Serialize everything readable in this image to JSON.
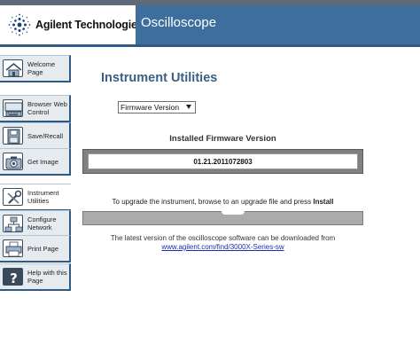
{
  "brand": {
    "name": "Agilent Technologies"
  },
  "header": {
    "title": "Oscilloscope"
  },
  "sidebar": {
    "items": [
      {
        "label": "Welcome Page",
        "icon": "home-icon",
        "active": false
      },
      {
        "label": "Browser Web Control",
        "icon": "keyboard-icon",
        "active": false
      },
      {
        "label": "Save/Recall",
        "icon": "floppy-disk-icon",
        "active": false
      },
      {
        "label": "Get Image",
        "icon": "camera-icon",
        "active": false
      },
      {
        "label": "Instrument Utilities",
        "icon": "tools-icon",
        "active": true
      },
      {
        "label": "Configure Network",
        "icon": "network-icon",
        "active": false
      },
      {
        "label": "Print Page",
        "icon": "printer-icon",
        "active": false
      },
      {
        "label": "Help with this Page",
        "icon": "help-icon",
        "active": false
      }
    ]
  },
  "main": {
    "title": "Instrument Utilities",
    "selector": {
      "value": "Firmware Version"
    },
    "installed_heading": "Installed Firmware Version",
    "installed_version": "01.21.2011072803",
    "upgrade_text_prefix": "To upgrade the instrument, browse to an upgrade file and press ",
    "upgrade_text_bold": "Install",
    "info_text": "The latest version of the oscilloscope software can be downloaded from",
    "info_link": "www.agilent.com/find/3000X-Series-sw"
  },
  "colors": {
    "header_band": "#3e6e9e",
    "header_rule": "#2e5a86",
    "page_title": "#3b5f82",
    "link": "#1a2fb0"
  }
}
